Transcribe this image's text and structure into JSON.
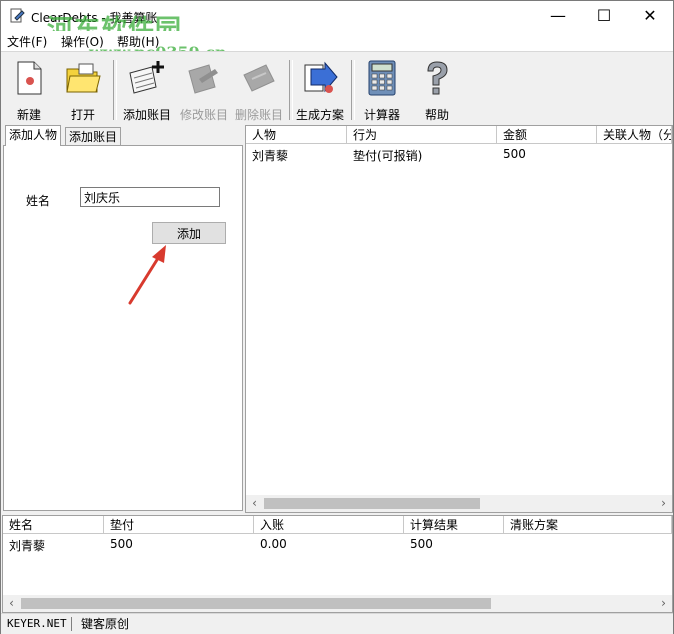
{
  "window": {
    "title": "ClearDebts - 我善算账",
    "minimize": "—",
    "maximize": "☐",
    "close": "✕"
  },
  "watermark": {
    "text": "河东软件园",
    "url": "www.pc0359.cn"
  },
  "menu": {
    "file": "文件(F)",
    "operate": "操作(O)",
    "help": "帮助(H)"
  },
  "toolbar": {
    "new": "新建",
    "open": "打开",
    "add_account": "添加账目",
    "edit_account": "修改账目",
    "delete_account": "删除账目",
    "generate_plan": "生成方案",
    "calculator": "计算器",
    "help": "帮助"
  },
  "tabs": {
    "add_person": "添加人物",
    "add_account": "添加账目"
  },
  "form": {
    "name_label": "姓名",
    "name_value": "刘庆乐",
    "add_button": "添加"
  },
  "accounts": {
    "columns": [
      "人物",
      "行为",
      "金额",
      "关联人物（分"
    ],
    "rows": [
      {
        "person": "刘青藜",
        "action": "垫付(可报销)",
        "amount": "500",
        "related": ""
      }
    ]
  },
  "summary": {
    "columns": [
      "姓名",
      "垫付",
      "入账",
      "计算结果",
      "清账方案"
    ],
    "rows": [
      {
        "name": "刘青藜",
        "advance": "500",
        "income": "0.00",
        "result": "500",
        "plan": ""
      }
    ]
  },
  "status": {
    "site": "KEYER.NET",
    "author": "键客原创"
  }
}
